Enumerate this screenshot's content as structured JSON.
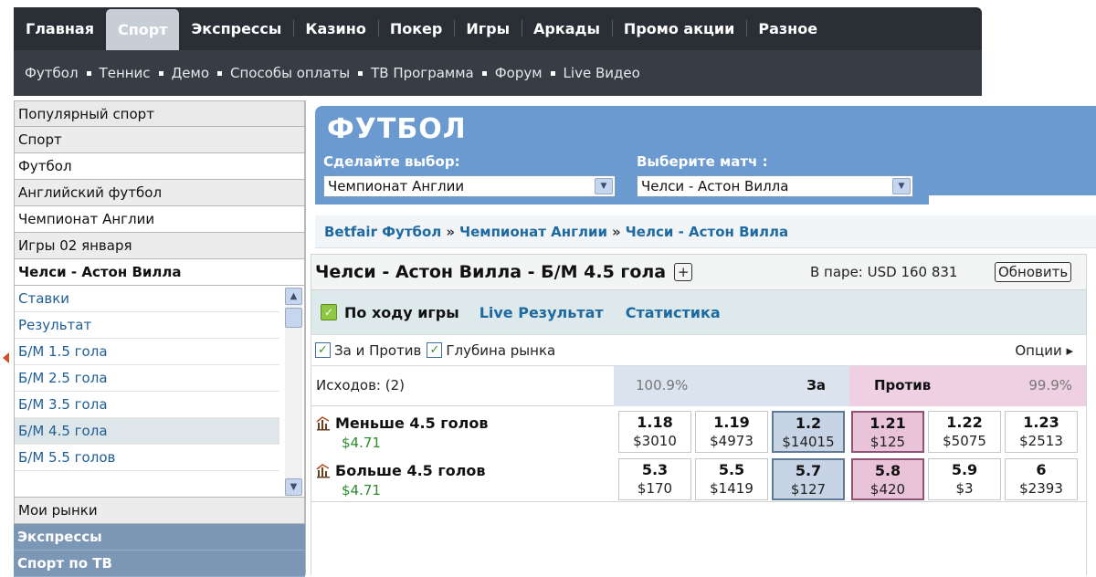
{
  "top_nav": {
    "tabs": [
      "Главная",
      "Спорт",
      "Экспрессы",
      "Казино",
      "Покер",
      "Игры",
      "Аркады",
      "Промо акции",
      "Разное"
    ],
    "active": "Спорт"
  },
  "sub_nav": [
    "Футбол",
    "Теннис",
    "Демо",
    "Способы оплаты",
    "ТВ Программа",
    "Форум",
    "Live Видео"
  ],
  "sidebar": {
    "rows": [
      "Популярный спорт",
      "Спорт",
      "Футбол",
      "Английский футбол",
      "Чемпионат Англии",
      "Игры 02 января"
    ],
    "current_match": "Челси - Астон Вилла",
    "markets": [
      "Ставки",
      "Результат",
      "Б/М 1.5 гола",
      "Б/М 2.5 гола",
      "Б/М 3.5 гола",
      "Б/М 4.5 гола",
      "Б/М 5.5 голов"
    ],
    "selected_market": "Б/М 4.5 гола",
    "my_markets": "Мои рынки",
    "blue_rows": [
      "Экспрессы",
      "Спорт по ТВ"
    ]
  },
  "header": {
    "title": "ФУТБОЛ",
    "select_label": "Сделайте выбор:",
    "select_value": "Чемпионат Англии",
    "match_label": "Выберите матч :",
    "match_value": "Челси - Астон Вилла"
  },
  "breadcrumb": [
    "Betfair Футбол",
    "Чемпионат Англии",
    "Челси - Астон Вилла"
  ],
  "breadcrumb_sep": "»",
  "market": {
    "title": "Челси - Астон Вилла - Б/М 4.5 гола",
    "plus": "+",
    "matched": "В паре: USD 160 831",
    "refresh": "Обновить",
    "inplay": "По ходу игры",
    "links": [
      "Live Результат",
      "Статистика"
    ],
    "option1": "За и Против",
    "option2": "Глубина рынка",
    "options_link": "Опции ▸",
    "outcomes": "Исходов: (2)",
    "back_pct": "100.9%",
    "back_label": "За",
    "lay_label": "Против",
    "lay_pct": "99.9%"
  },
  "runners": [
    {
      "name": "Меньше 4.5 голов",
      "pl": "$4.71",
      "prices": [
        {
          "odds": "1.18",
          "amt": "$3010"
        },
        {
          "odds": "1.19",
          "amt": "$4973"
        },
        {
          "odds": "1.2",
          "amt": "$14015"
        },
        {
          "odds": "1.21",
          "amt": "$125"
        },
        {
          "odds": "1.22",
          "amt": "$5075"
        },
        {
          "odds": "1.23",
          "amt": "$2513"
        }
      ]
    },
    {
      "name": "Больше 4.5 голов",
      "pl": "$4.71",
      "prices": [
        {
          "odds": "5.3",
          "amt": "$170"
        },
        {
          "odds": "5.5",
          "amt": "$1419"
        },
        {
          "odds": "5.7",
          "amt": "$127"
        },
        {
          "odds": "5.8",
          "amt": "$420"
        },
        {
          "odds": "5.9",
          "amt": "$3"
        },
        {
          "odds": "6",
          "amt": "$2393"
        }
      ]
    }
  ],
  "colors": {
    "nav_bg": "#2a2f36",
    "header_blue": "#6a9ad0",
    "back_blue": "#c7d4e6",
    "lay_pink": "#e9c3d8",
    "link_blue": "#1e6aa0",
    "pl_green": "#2e8a2e"
  }
}
